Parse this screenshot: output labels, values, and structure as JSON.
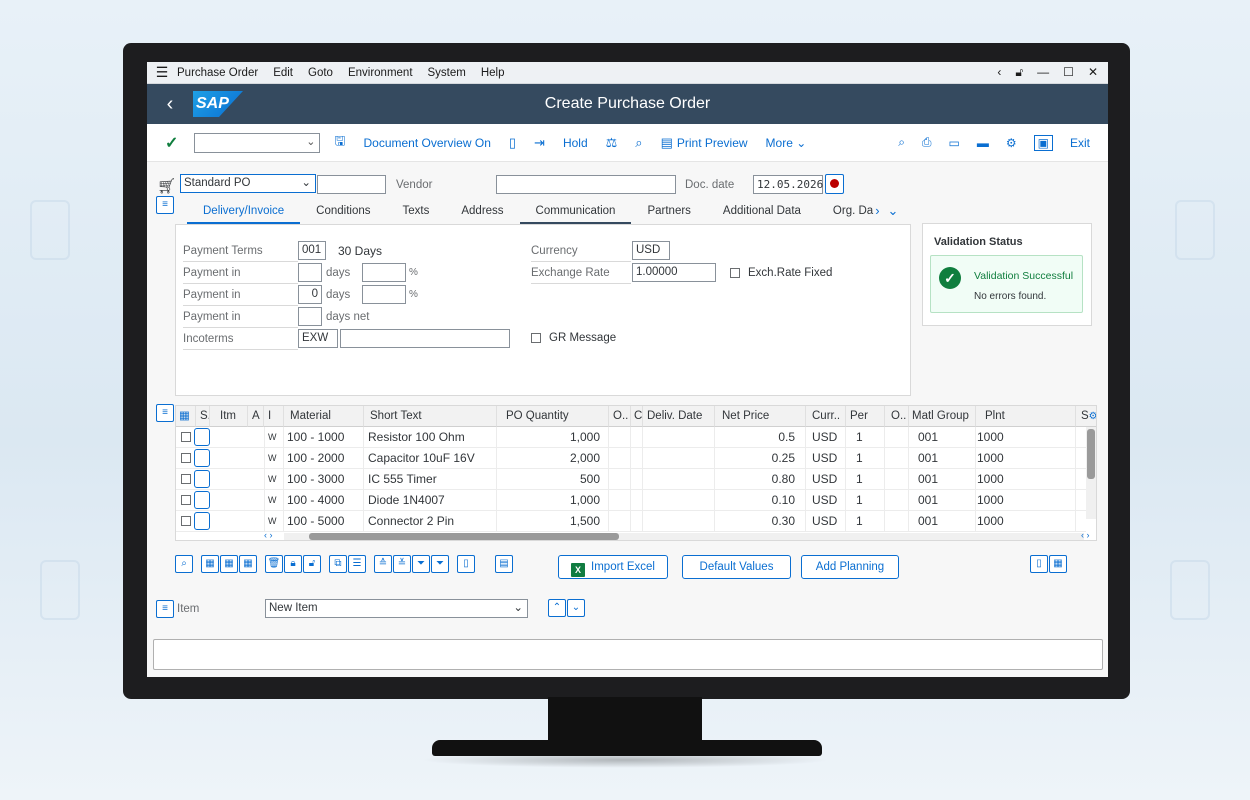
{
  "menubar": {
    "items": [
      "Purchase Order",
      "Edit",
      "Goto",
      "Environment",
      "System",
      "Help"
    ]
  },
  "shell": {
    "logo": "SAP",
    "title": "Create Purchase Order"
  },
  "toolbar": {
    "document_overview": "Document Overview On",
    "hold": "Hold",
    "print_preview": "Print Preview",
    "more": "More",
    "exit": "Exit"
  },
  "header": {
    "po_type": "Standard PO",
    "vendor_label": "Vendor",
    "vendor_value": "",
    "doc_date_label": "Doc. date",
    "doc_date_value": "12.05.2026"
  },
  "tabs": [
    "Delivery/Invoice",
    "Conditions",
    "Texts",
    "Address",
    "Communication",
    "Partners",
    "Additional Data",
    "Org. Da"
  ],
  "delivery_invoice": {
    "payment_terms_label": "Payment Terms",
    "payment_terms_code": "001",
    "payment_terms_text": "30 Days",
    "payment_in_label": "Payment in",
    "days": "days",
    "percent": "%",
    "payment_in_2_value": "0",
    "days_net": "days net",
    "incoterms_label": "Incoterms",
    "incoterms_value": "EXW",
    "currency_label": "Currency",
    "currency_value": "USD",
    "exchange_rate_label": "Exchange Rate",
    "exchange_rate_value": "1.00000",
    "exch_rate_fixed": "Exch.Rate Fixed",
    "gr_message": "GR Message"
  },
  "validation": {
    "title": "Validation Status",
    "status": "Validation Successful",
    "detail": "No errors found."
  },
  "items_table": {
    "headers": [
      "S.",
      "Itm",
      "A",
      "I",
      "Material",
      "Short Text",
      "PO Quantity",
      "O..",
      "C",
      "Deliv. Date",
      "Net Price",
      "Curr..",
      "Per",
      "O..",
      "Matl Group",
      "Plnt",
      "S"
    ],
    "rows": [
      {
        "cat": "W",
        "material": "100 - 1000",
        "short_text": "Resistor 100 Ohm",
        "qty": "1,000",
        "net_price": "0.5",
        "curr": "USD",
        "per": "1",
        "matl_group": "001",
        "plant": "1000"
      },
      {
        "cat": "W",
        "material": "100 - 2000",
        "short_text": "Capacitor 10uF 16V",
        "qty": "2,000",
        "net_price": "0.25",
        "curr": "USD",
        "per": "1",
        "matl_group": "001",
        "plant": "1000"
      },
      {
        "cat": "W",
        "material": "100 - 3000",
        "short_text": "IC 555 Timer",
        "qty": "500",
        "net_price": "0.80",
        "curr": "USD",
        "per": "1",
        "matl_group": "001",
        "plant": "1000"
      },
      {
        "cat": "W",
        "material": "100 - 4000",
        "short_text": "Diode 1N4007",
        "qty": "1,000",
        "net_price": "0.10",
        "curr": "USD",
        "per": "1",
        "matl_group": "001",
        "plant": "1000"
      },
      {
        "cat": "W",
        "material": "100 - 5000",
        "short_text": "Connector 2 Pin",
        "qty": "1,500",
        "net_price": "0.30",
        "curr": "USD",
        "per": "1",
        "matl_group": "001",
        "plant": "1000"
      }
    ]
  },
  "actions": {
    "import_excel": "Import Excel",
    "default_values": "Default Values",
    "add_planning": "Add Planning"
  },
  "item_selector": {
    "label": "Item",
    "value": "New Item"
  },
  "colors": {
    "shell": "#354a5f",
    "accent": "#0a6ed1",
    "success": "#107e3e",
    "record_red": "#bb0000"
  }
}
